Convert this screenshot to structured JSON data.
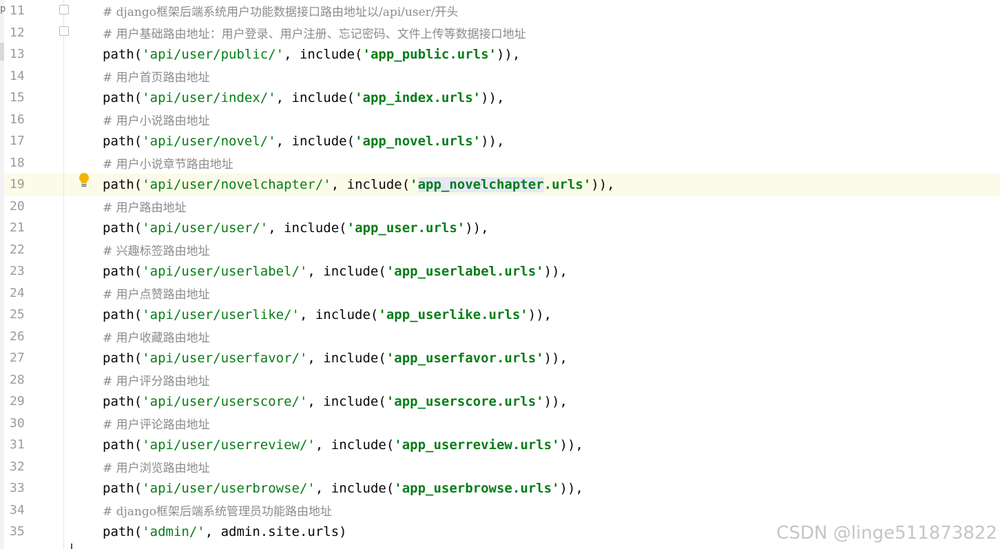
{
  "editor": {
    "lines": [
      {
        "n": "11",
        "kind": "comment",
        "text": "# django框架后端系统用户功能数据接口路由地址以/api/user/开头"
      },
      {
        "n": "12",
        "kind": "comment",
        "text": "# 用户基础路由地址：用户登录、用户注册、忘记密码、文件上传等数据接口地址"
      },
      {
        "n": "13",
        "kind": "path",
        "route": "'api/user/public/'",
        "mod": "app_public",
        "end": ")),"
      },
      {
        "n": "14",
        "kind": "comment",
        "text": "# 用户首页路由地址"
      },
      {
        "n": "15",
        "kind": "path",
        "route": "'api/user/index/'",
        "mod": "app_index",
        "end": ")),"
      },
      {
        "n": "16",
        "kind": "comment",
        "text": "# 用户小说路由地址"
      },
      {
        "n": "17",
        "kind": "path",
        "route": "'api/user/novel/'",
        "mod": "app_novel",
        "end": ")),"
      },
      {
        "n": "18",
        "kind": "comment",
        "text": "# 用户小说章节路由地址"
      },
      {
        "n": "19",
        "kind": "path",
        "route": "'api/user/novelchapter/'",
        "mod": "app_novelchapter",
        "end": ")),",
        "current": true
      },
      {
        "n": "20",
        "kind": "comment",
        "text": "# 用户路由地址"
      },
      {
        "n": "21",
        "kind": "path",
        "route": "'api/user/user/'",
        "mod": "app_user",
        "end": ")),"
      },
      {
        "n": "22",
        "kind": "comment",
        "text": "# 兴趣标签路由地址"
      },
      {
        "n": "23",
        "kind": "path",
        "route": "'api/user/userlabel/'",
        "mod": "app_userlabel",
        "end": ")),"
      },
      {
        "n": "24",
        "kind": "comment",
        "text": "# 用户点赞路由地址"
      },
      {
        "n": "25",
        "kind": "path",
        "route": "'api/user/userlike/'",
        "mod": "app_userlike",
        "end": ")),"
      },
      {
        "n": "26",
        "kind": "comment",
        "text": "# 用户收藏路由地址"
      },
      {
        "n": "27",
        "kind": "path",
        "route": "'api/user/userfavor/'",
        "mod": "app_userfavor",
        "end": ")),"
      },
      {
        "n": "28",
        "kind": "comment",
        "text": "# 用户评分路由地址"
      },
      {
        "n": "29",
        "kind": "path",
        "route": "'api/user/userscore/'",
        "mod": "app_userscore",
        "end": ")),"
      },
      {
        "n": "30",
        "kind": "comment",
        "text": "# 用户评论路由地址"
      },
      {
        "n": "31",
        "kind": "path",
        "route": "'api/user/userreview/'",
        "mod": "app_userreview",
        "end": ")),"
      },
      {
        "n": "32",
        "kind": "comment",
        "text": "# 用户浏览路由地址"
      },
      {
        "n": "33",
        "kind": "path",
        "route": "'api/user/userbrowse/'",
        "mod": "app_userbrowse",
        "end": ")),"
      },
      {
        "n": "34",
        "kind": "comment",
        "text": "# django框架后端系统管理员功能路由地址"
      },
      {
        "n": "35",
        "kind": "admin",
        "text_a": "path(",
        "route": "'admin/'",
        "text_b": ", admin.site.urls)"
      }
    ],
    "kw_path": "path(",
    "kw_include": ", include(",
    "urls_suffix": ".urls'",
    "quote_open": "'"
  },
  "colors": {
    "string": "#067d17",
    "comment": "#8c8c8c",
    "current_line": "#fcfae8",
    "line_number": "#9b9b9b"
  },
  "icons": {
    "intention": "lightbulb-icon",
    "fold": "fold-marker-icon"
  },
  "watermark": "CSDN @linge511873822",
  "left_strip_letter": "p"
}
